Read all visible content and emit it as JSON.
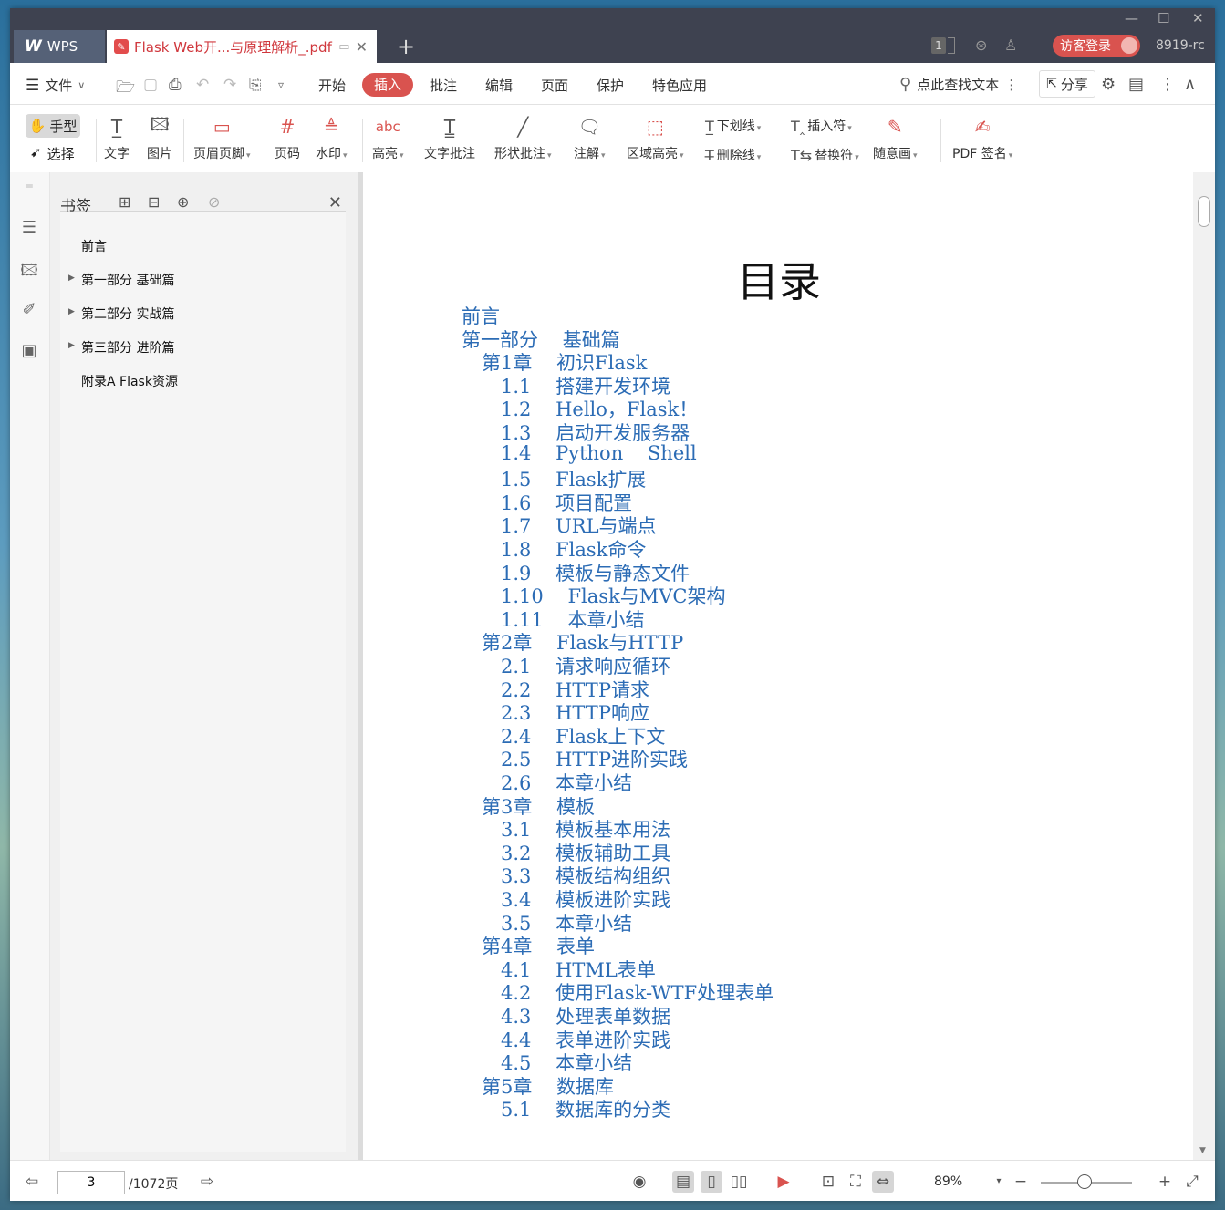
{
  "titlebar": {
    "app_tab": "WPS",
    "app_logo_text": "W",
    "doc_tab_title": "Flask Web开...与原理解析_.pdf",
    "badge": "1",
    "login_label": "访客登录",
    "version": "8919-rc"
  },
  "menubar": {
    "file_label": "文件",
    "tabs": [
      "开始",
      "插入",
      "批注",
      "编辑",
      "页面",
      "保护",
      "特色应用"
    ],
    "active_tab": "插入",
    "search_label": "点此查找文本",
    "share_label": "分享"
  },
  "toolbar": {
    "hand_label": "手型",
    "select_label": "选择",
    "tools": [
      "文字",
      "图片",
      "页眉页脚",
      "页码",
      "水印",
      "高亮",
      "文字批注",
      "形状批注",
      "注解",
      "区域高亮",
      "随意画",
      "PDF 签名"
    ],
    "underline_label": "下划线",
    "insert_char_label": "插入符",
    "strike_label": "删除线",
    "replace_char_label": "替换符"
  },
  "bookmarks": {
    "title": "书签",
    "items": [
      "前言",
      "第一部分 基础篇",
      "第二部分 实战篇",
      "第三部分 进阶篇",
      "附录A Flask资源"
    ]
  },
  "document": {
    "title": "目录",
    "toc": [
      {
        "text": "前言",
        "level": 0
      },
      {
        "text": "第一部分    基础篇",
        "level": 0
      },
      {
        "text": "第1章    初识Flask",
        "level": 1
      },
      {
        "text": "1.1    搭建开发环境",
        "level": 2
      },
      {
        "text": "1.2    Hello，Flask！",
        "level": 2
      },
      {
        "text": "1.3    启动开发服务器",
        "level": 2
      },
      {
        "text": "1.4    Python    Shell",
        "level": 2
      },
      {
        "text": "1.5    Flask扩展",
        "level": 2
      },
      {
        "text": "1.6    项目配置",
        "level": 2
      },
      {
        "text": "1.7    URL与端点",
        "level": 2
      },
      {
        "text": "1.8    Flask命令",
        "level": 2
      },
      {
        "text": "1.9    模板与静态文件",
        "level": 2
      },
      {
        "text": "1.10    Flask与MVC架构",
        "level": 2
      },
      {
        "text": "1.11    本章小结",
        "level": 2
      },
      {
        "text": "第2章    Flask与HTTP",
        "level": 1
      },
      {
        "text": "2.1    请求响应循环",
        "level": 2
      },
      {
        "text": "2.2    HTTP请求",
        "level": 2
      },
      {
        "text": "2.3    HTTP响应",
        "level": 2
      },
      {
        "text": "2.4    Flask上下文",
        "level": 2
      },
      {
        "text": "2.5    HTTP进阶实践",
        "level": 2
      },
      {
        "text": "2.6    本章小结",
        "level": 2
      },
      {
        "text": "第3章    模板",
        "level": 1
      },
      {
        "text": "3.1    模板基本用法",
        "level": 2
      },
      {
        "text": "3.2    模板辅助工具",
        "level": 2
      },
      {
        "text": "3.3    模板结构组织",
        "level": 2
      },
      {
        "text": "3.4    模板进阶实践",
        "level": 2
      },
      {
        "text": "3.5    本章小结",
        "level": 2
      },
      {
        "text": "第4章    表单",
        "level": 1
      },
      {
        "text": "4.1    HTML表单",
        "level": 2
      },
      {
        "text": "4.2    使用Flask-WTF处理表单",
        "level": 2
      },
      {
        "text": "4.3    处理表单数据",
        "level": 2
      },
      {
        "text": "4.4    表单进阶实践",
        "level": 2
      },
      {
        "text": "4.5    本章小结",
        "level": 2
      },
      {
        "text": "第5章    数据库",
        "level": 1
      },
      {
        "text": "5.1    数据库的分类",
        "level": 2
      }
    ]
  },
  "statusbar": {
    "current_page": "3",
    "total_pages": "/1072页",
    "zoom": "89%"
  },
  "colors": {
    "accent": "#d9534f",
    "link": "#2c6cb5"
  }
}
